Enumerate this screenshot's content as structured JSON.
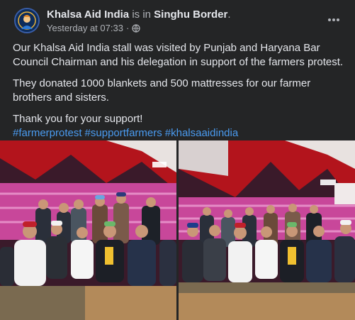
{
  "post": {
    "author": "Khalsa Aid India",
    "is_in": "is in",
    "location": "Singhu Border",
    "location_suffix": ".",
    "timestamp": "Yesterday at 07:33",
    "separator": "·",
    "more_icon": "ellipsis-icon",
    "privacy_icon": "globe-icon",
    "paragraphs": [
      "Our Khalsa Aid India stall was visited by Punjab and Haryana Bar Council Chairman and his delegation in support of the farmers protest.",
      "They donated 1000 blankets and 500 mattresses for our farmer brothers and sisters.",
      "Thank you for your support!"
    ],
    "hashtags": [
      "#farmerprotest",
      "#supportfarmers",
      "#khalsaaidindia"
    ]
  },
  "colors": {
    "background": "#242526",
    "text": "#e4e6eb",
    "muted": "#b0b3b8",
    "hashtag": "#4a9bf0",
    "tent_red": "#b3141c",
    "tent_pink": "#d24fa0"
  }
}
